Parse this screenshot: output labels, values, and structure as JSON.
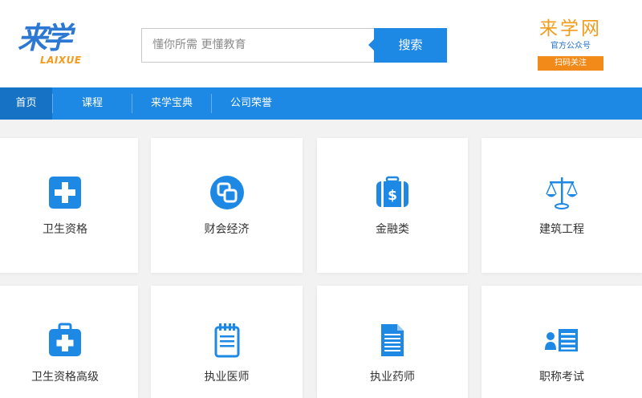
{
  "header": {
    "logo_text": "来学",
    "logo_sub": "LAIXUE",
    "search_placeholder": "懂你所需 更懂教育",
    "search_button": "搜索",
    "qr_title": "来学网",
    "qr_sub": "官方公众号",
    "qr_button": "扫码关注"
  },
  "nav": {
    "items": [
      {
        "label": "首页"
      },
      {
        "label": "课程"
      },
      {
        "label": "来学宝典"
      },
      {
        "label": "公司荣誉"
      }
    ]
  },
  "categories": [
    {
      "label": "卫生资格",
      "icon": "medical-cross-icon"
    },
    {
      "label": "财会经济",
      "icon": "coins-icon"
    },
    {
      "label": "金融类",
      "icon": "money-bag-icon"
    },
    {
      "label": "建筑工程",
      "icon": "scales-icon"
    },
    {
      "label": "卫生资格高级",
      "icon": "medical-kit-icon"
    },
    {
      "label": "执业医师",
      "icon": "notepad-icon"
    },
    {
      "label": "执业药师",
      "icon": "document-icon"
    },
    {
      "label": "职称考试",
      "icon": "id-card-icon"
    }
  ],
  "colors": {
    "brand_blue": "#1e88e5",
    "accent_orange": "#f29b1d",
    "nav_active": "#1572c4"
  }
}
